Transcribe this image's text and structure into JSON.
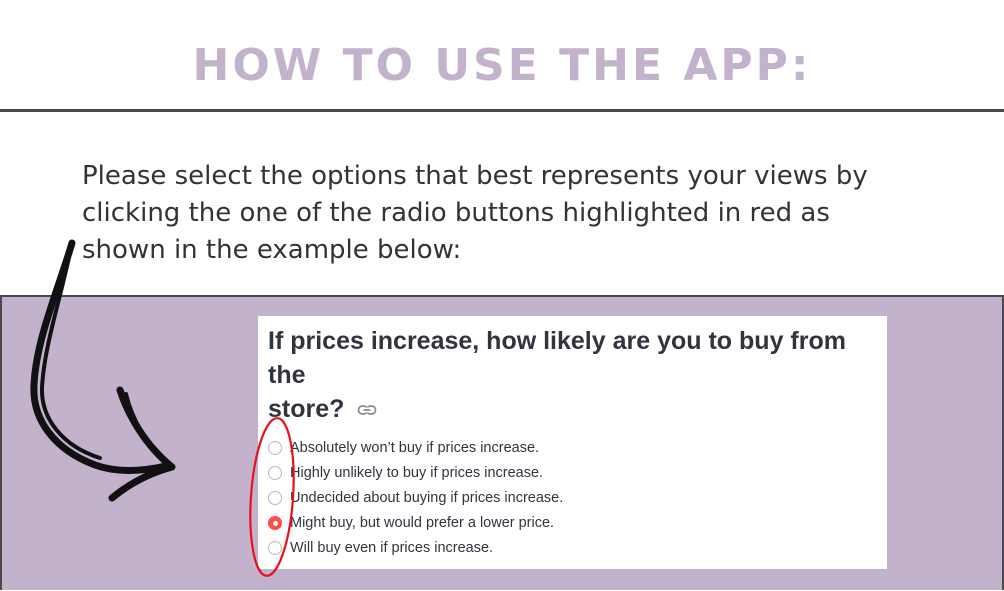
{
  "heading": "HOW TO USE THE APP:",
  "instructions": {
    "line1": "Please select the options that best represents your views by",
    "line2": "clicking the one of the radio buttons highlighted in red as",
    "line3": "shown in the example below:"
  },
  "example": {
    "question_line1": "If prices increase, how likely are you to buy from the",
    "question_line2": "store?",
    "link_icon": "link-icon",
    "options": [
      {
        "label": "Absolutely won’t buy if prices increase.",
        "selected": false
      },
      {
        "label": "Highly unlikely to buy if prices increase.",
        "selected": false
      },
      {
        "label": "Undecided about buying if prices increase.",
        "selected": false
      },
      {
        "label": "Might buy, but would prefer a lower price.",
        "selected": true
      },
      {
        "label": "Will buy even if prices increase.",
        "selected": false
      }
    ]
  },
  "colors": {
    "heading": "#c3b2cb",
    "panel": "#c3b2cb",
    "divider": "#4a4a4a",
    "highlight_ellipse": "#e8121c",
    "radio_selected": "#ff4b4b",
    "arrow": "#111111"
  }
}
